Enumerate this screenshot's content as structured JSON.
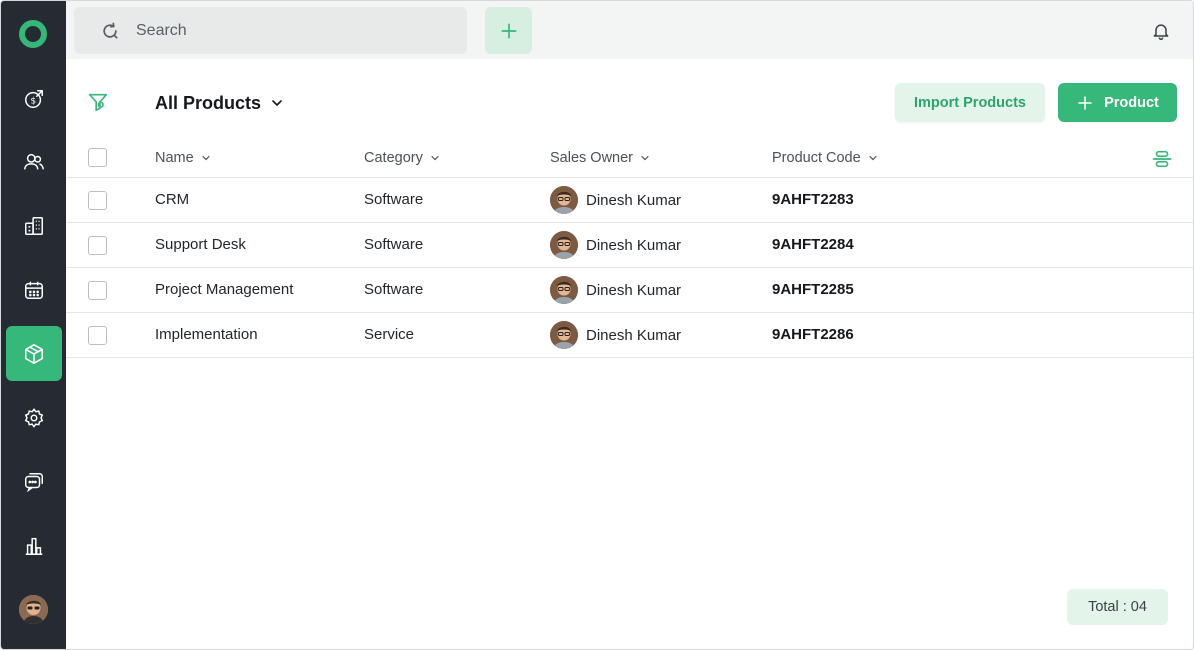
{
  "sidebar": {
    "items": [
      {
        "name": "deals-icon"
      },
      {
        "name": "contacts-icon"
      },
      {
        "name": "companies-icon"
      },
      {
        "name": "calendar-icon"
      },
      {
        "name": "products-icon",
        "active": true
      },
      {
        "name": "settings-icon"
      },
      {
        "name": "chat-icon"
      },
      {
        "name": "reports-icon"
      }
    ]
  },
  "topbar": {
    "search_placeholder": "Search"
  },
  "header": {
    "view_title": "All Products",
    "import_label": "Import Products",
    "add_label": "Product"
  },
  "table": {
    "columns": {
      "name": "Name",
      "category": "Category",
      "owner": "Sales Owner",
      "code": "Product Code"
    },
    "rows": [
      {
        "name": "CRM",
        "category": "Software",
        "owner": "Dinesh Kumar",
        "code": "9AHFT2283"
      },
      {
        "name": "Support Desk",
        "category": "Software",
        "owner": "Dinesh Kumar",
        "code": "9AHFT2284"
      },
      {
        "name": "Project Management",
        "category": "Software",
        "owner": "Dinesh Kumar",
        "code": "9AHFT2285"
      },
      {
        "name": "Implementation",
        "category": "Service",
        "owner": "Dinesh Kumar",
        "code": "9AHFT2286"
      }
    ]
  },
  "footer": {
    "total": "Total : 04"
  },
  "colors": {
    "accent": "#35b879",
    "sidebar_bg": "#262a33",
    "accent_light": "#e3f4ea"
  }
}
